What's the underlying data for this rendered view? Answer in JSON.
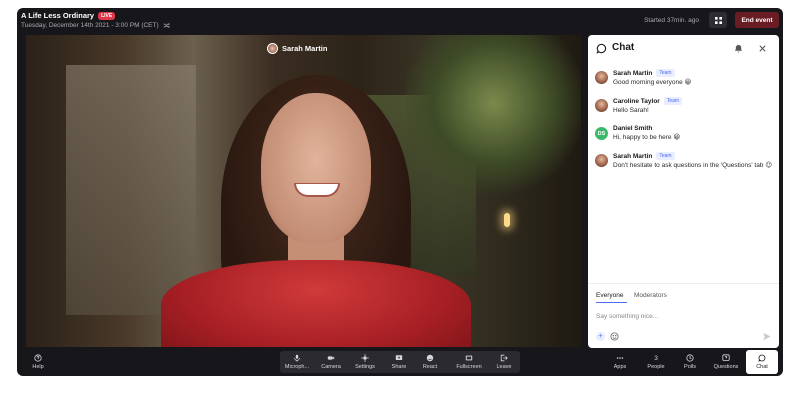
{
  "header": {
    "title": "A Life Less Ordinary",
    "live_badge": "LIVE",
    "subtitle": "Tuesday, December 14th 2021 - 3:00 PM (CET)",
    "started": "Started 37min. ago",
    "end_button": "End event"
  },
  "video": {
    "speaker_name": "Sarah Martin"
  },
  "chat": {
    "title": "Chat",
    "messages": [
      {
        "name": "Sarah Martin",
        "badge": "Team",
        "text": "Good morning everyone 😀"
      },
      {
        "name": "Caroline Taylor",
        "badge": "Team",
        "text": "Hello Sarah!"
      },
      {
        "name": "Daniel Smith",
        "initials": "DS",
        "text": "Hi, happy to be here 😀"
      },
      {
        "name": "Sarah Martin",
        "badge": "Team",
        "text": "Don't hesitate to ask questions in the 'Questions' tab 😉"
      }
    ],
    "tabs": [
      "Everyone",
      "Moderators"
    ],
    "input_placeholder": "Say something nice...",
    "plus": "+"
  },
  "toolbar": {
    "help": "Help",
    "center": [
      "Microph...",
      "Camera",
      "Settings",
      "Share",
      "React",
      "Fullscreen",
      "Leave"
    ],
    "right": {
      "apps": "Apps",
      "people_count": "3",
      "people": "People",
      "polls": "Polls",
      "questions": "Questions",
      "chat": "Chat"
    }
  },
  "colors": {
    "background": "#17171b",
    "live_badge": "#e0384b",
    "end_button": "#6a1c25",
    "accent": "#4a6cf0",
    "initials_avatar": "#3bb96a"
  }
}
